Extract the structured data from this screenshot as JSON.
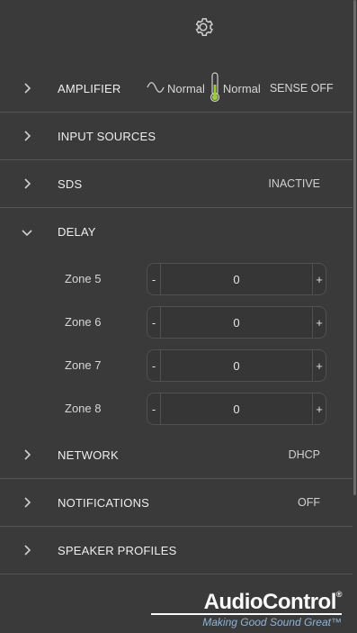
{
  "icons": {
    "settings": "gear-icon",
    "collapsed": "chevron-right-icon",
    "expanded": "chevron-down-icon",
    "wave": "sine-wave-icon",
    "temp": "thermometer-icon"
  },
  "sections": {
    "amplifier": {
      "label": "AMPLIFIER",
      "signal_status": "Normal",
      "temp_status": "Normal",
      "sense": "SENSE OFF"
    },
    "input_sources": {
      "label": "INPUT SOURCES"
    },
    "sds": {
      "label": "SDS",
      "status": "INACTIVE"
    },
    "delay": {
      "label": "DELAY",
      "zones": [
        {
          "label": "Zone 5",
          "value": "0",
          "minus": "-",
          "plus": "+"
        },
        {
          "label": "Zone 6",
          "value": "0",
          "minus": "-",
          "plus": "+"
        },
        {
          "label": "Zone 7",
          "value": "0",
          "minus": "-",
          "plus": "+"
        },
        {
          "label": "Zone 8",
          "value": "0",
          "minus": "-",
          "plus": "+"
        }
      ]
    },
    "network": {
      "label": "NETWORK",
      "status": "DHCP"
    },
    "notifications": {
      "label": "NOTIFICATIONS",
      "status": "OFF"
    },
    "speaker_profiles": {
      "label": "SPEAKER PROFILES"
    }
  },
  "logo": {
    "name": "AudioControl",
    "reg": "®",
    "tagline": "Making Good Sound Great™"
  },
  "colors": {
    "background": "#3a3a3a",
    "divider": "#555555",
    "thermometer_fill": "#9acd32",
    "tagline": "#8fb4d6"
  }
}
